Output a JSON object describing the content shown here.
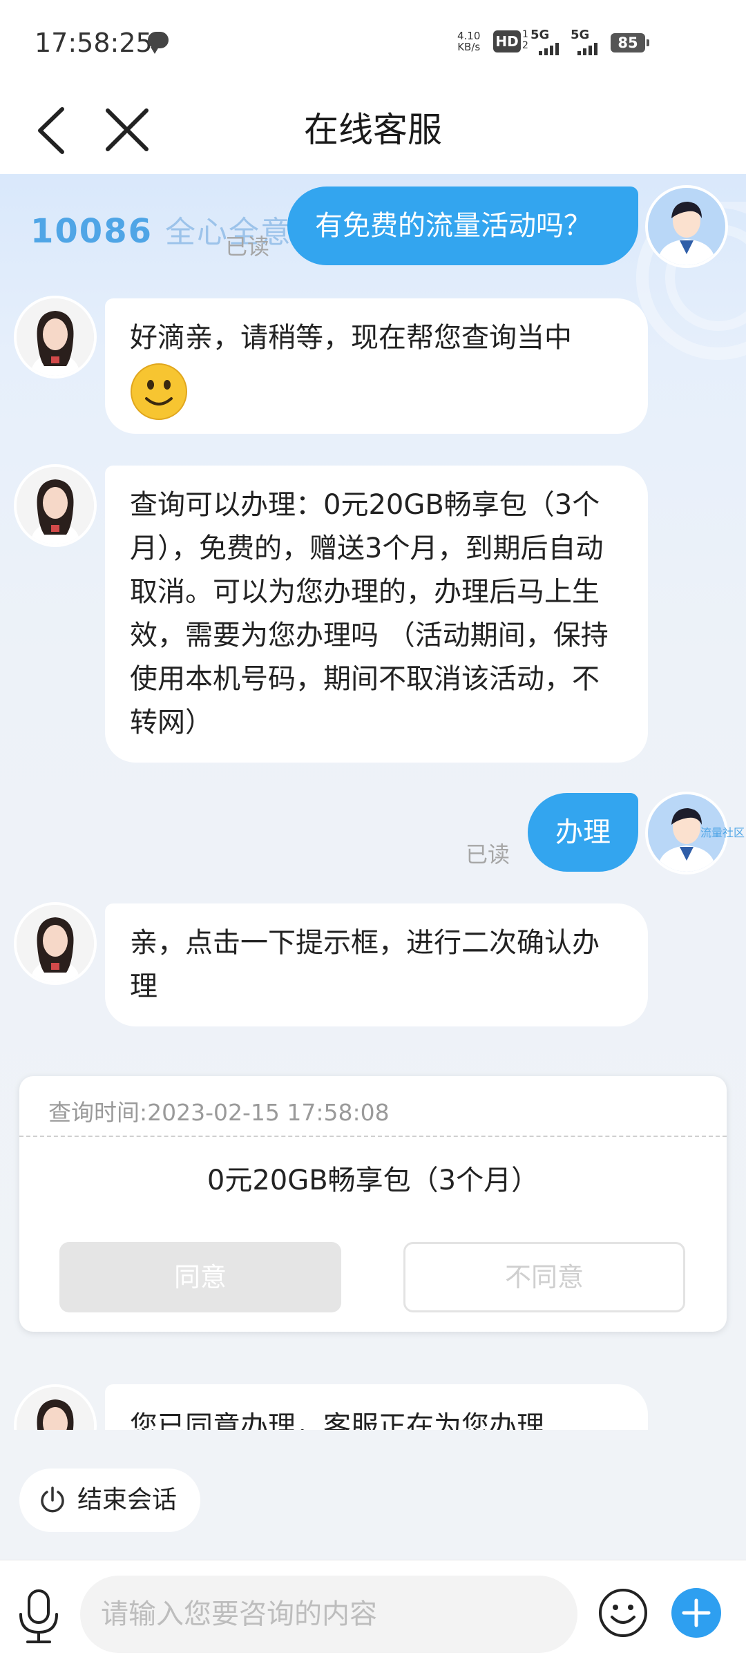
{
  "status_bar": {
    "time": "17:58:25",
    "net_speed_value": "4.10",
    "net_speed_unit": "KB/s",
    "hd_label": "HD",
    "hd_sub_1": "1",
    "hd_sub_2": "2",
    "network_1": "5G",
    "network_2": "5G",
    "battery": "85"
  },
  "header": {
    "title": "在线客服"
  },
  "banner": {
    "number": "10086",
    "slogan": "全心全意为您"
  },
  "side_label": "流量社区",
  "messages": [
    {
      "from": "user",
      "text": "有免费的流量活动吗？",
      "read_label": "已读"
    },
    {
      "from": "agent",
      "text": "好滴亲，请稍等，现在帮您查询当中"
    },
    {
      "from": "agent",
      "text": "查询可以办理：0元20GB畅享包（3个月），免费的，赠送3个月，到期后自动取消。可以为您办理的，办理后马上生效，需要为您办理吗 （活动期间，保持使用本机号码，期间不取消该活动，不转网）"
    },
    {
      "from": "user",
      "text": "办理",
      "read_label": "已读"
    },
    {
      "from": "agent",
      "text": "亲，点击一下提示框，进行二次确认办理"
    },
    {
      "from": "agent",
      "text": "您已同意办理，客服正在为您办理"
    }
  ],
  "confirm_card": {
    "query_time": "查询时间:2023-02-15 17:58:08",
    "product": "0元20GB畅享包（3个月）",
    "agree_label": "同意",
    "disagree_label": "不同意"
  },
  "end_session_label": "结束会话",
  "input": {
    "placeholder": "请输入您要咨询的内容"
  },
  "colors": {
    "user_bubble": "#33a5ef",
    "chat_background": "#e6effb"
  }
}
